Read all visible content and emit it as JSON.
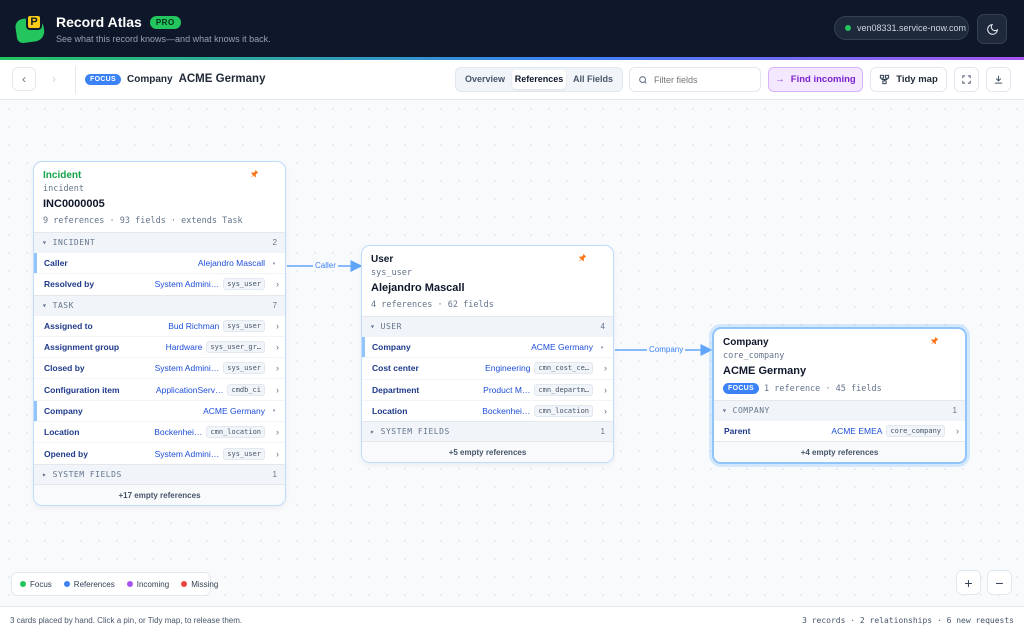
{
  "app": {
    "name": "Record Atlas",
    "badge": "PRO",
    "tagline": "See what this record knows—and what knows it back.",
    "instance": "ven08331.service-now.com"
  },
  "toolbar": {
    "focus_badge": "FOCUS",
    "focus_table": "Company",
    "focus_name": "ACME Germany",
    "tabs": [
      {
        "label": "Overview",
        "active": false
      },
      {
        "label": "References",
        "active": true
      },
      {
        "label": "All Fields",
        "active": false
      }
    ],
    "filter_placeholder": "Filter fields",
    "find_incoming": "Find incoming",
    "tidy_map": "Tidy map"
  },
  "edges": [
    {
      "label": "Caller"
    },
    {
      "label": "Company"
    }
  ],
  "cards": {
    "incident": {
      "table": "Incident",
      "sys": "incident",
      "title": "INC0000005",
      "meta": "9 references · 93 fields · extends Task",
      "sections": [
        {
          "name": "INCIDENT",
          "count": "2",
          "rows": [
            {
              "label": "Caller",
              "value": "Alejandro Mascall",
              "tag": "",
              "end": "•",
              "hl": true
            },
            {
              "label": "Resolved by",
              "value": "System Admini…",
              "tag": "sys_user",
              "end": "›",
              "hl": false
            }
          ]
        },
        {
          "name": "TASK",
          "count": "7",
          "rows": [
            {
              "label": "Assigned to",
              "value": "Bud Richman",
              "tag": "sys_user",
              "end": "›",
              "hl": false
            },
            {
              "label": "Assignment group",
              "value": "Hardware",
              "tag": "sys_user_gr…",
              "end": "›",
              "hl": false
            },
            {
              "label": "Closed by",
              "value": "System Admini…",
              "tag": "sys_user",
              "end": "›",
              "hl": false
            },
            {
              "label": "Configuration item",
              "value": "ApplicationServ…",
              "tag": "cmdb_ci",
              "end": "›",
              "hl": false
            },
            {
              "label": "Company",
              "value": "ACME Germany",
              "tag": "",
              "end": "•",
              "hl": true
            },
            {
              "label": "Location",
              "value": "Bockenhei…",
              "tag": "cmn_location",
              "end": "›",
              "hl": false
            },
            {
              "label": "Opened by",
              "value": "System Admini…",
              "tag": "sys_user",
              "end": "›",
              "hl": false
            }
          ]
        }
      ],
      "system_fields": {
        "name": "SYSTEM FIELDS",
        "count": "1"
      },
      "footer": "+17 empty references"
    },
    "user": {
      "table": "User",
      "sys": "sys_user",
      "title": "Alejandro Mascall",
      "meta": "4 references · 62 fields",
      "sections": [
        {
          "name": "USER",
          "count": "4",
          "rows": [
            {
              "label": "Company",
              "value": "ACME Germany",
              "tag": "",
              "end": "•",
              "hl": true
            },
            {
              "label": "Cost center",
              "value": "Engineering",
              "tag": "cmn_cost_ce…",
              "end": "›",
              "hl": false
            },
            {
              "label": "Department",
              "value": "Product M…",
              "tag": "cmn_departm…",
              "end": "›",
              "hl": false
            },
            {
              "label": "Location",
              "value": "Bockenhei…",
              "tag": "cmn_location",
              "end": "›",
              "hl": false
            }
          ]
        }
      ],
      "system_fields": {
        "name": "SYSTEM FIELDS",
        "count": "1"
      },
      "footer": "+5 empty references"
    },
    "company": {
      "table": "Company",
      "sys": "core_company",
      "title": "ACME Germany",
      "badge": "FOCUS",
      "meta": "1 reference · 45 fields",
      "sections": [
        {
          "name": "COMPANY",
          "count": "1",
          "rows": [
            {
              "label": "Parent",
              "value": "ACME EMEA",
              "tag": "core_company",
              "end": "›",
              "hl": false
            }
          ]
        }
      ],
      "footer": "+4 empty references"
    }
  },
  "legend": [
    {
      "label": "Focus",
      "color": "#22c55e"
    },
    {
      "label": "References",
      "color": "#3b82f6"
    },
    {
      "label": "Incoming",
      "color": "#a855f7"
    },
    {
      "label": "Missing",
      "color": "#ef4444"
    }
  ],
  "status": {
    "left": "3 cards placed by hand. Click a pin, or Tidy map, to release them.",
    "right": "3 records · 2 relationships · 6 new requests"
  }
}
